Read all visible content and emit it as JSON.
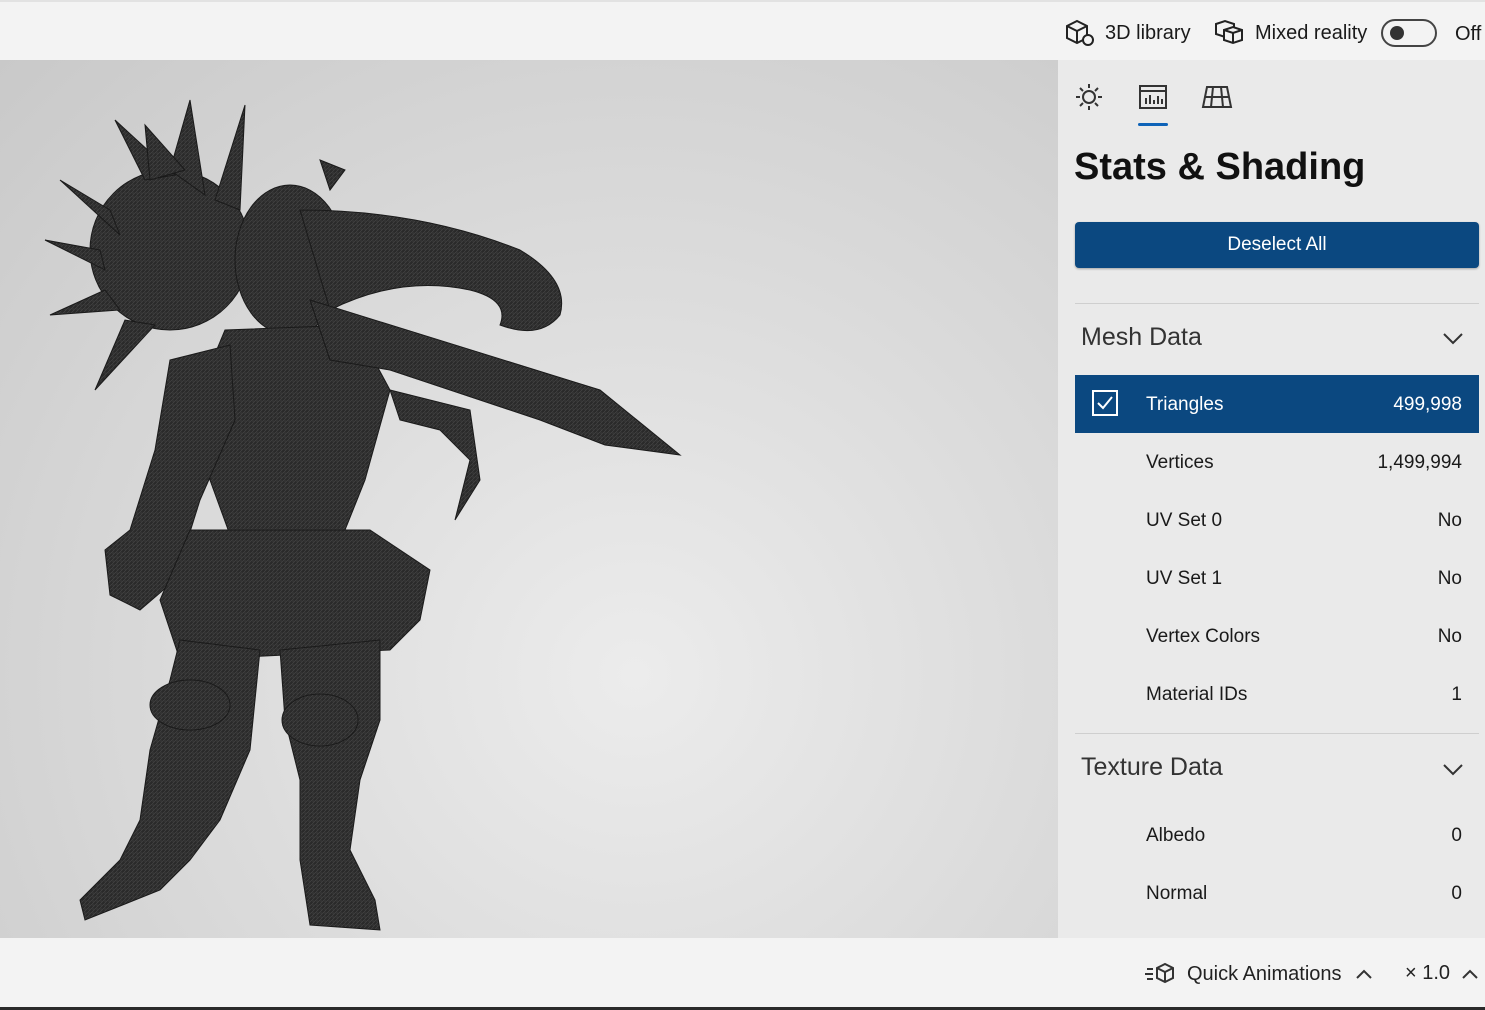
{
  "toolbar": {
    "library_label": "3D library",
    "mixed_reality_label": "Mixed reality",
    "toggle_state": "Off"
  },
  "panel": {
    "title": "Stats & Shading",
    "deselect_label": "Deselect All",
    "tabs": [
      "lighting-tab",
      "stats-tab",
      "grid-tab"
    ],
    "mesh": {
      "header": "Mesh Data",
      "rows": [
        {
          "label": "Triangles",
          "value": "499,998",
          "selected": true
        },
        {
          "label": "Vertices",
          "value": "1,499,994"
        },
        {
          "label": "UV Set 0",
          "value": "No"
        },
        {
          "label": "UV Set 1",
          "value": "No"
        },
        {
          "label": "Vertex Colors",
          "value": "No"
        },
        {
          "label": "Material IDs",
          "value": "1"
        }
      ]
    },
    "texture": {
      "header": "Texture Data",
      "rows": [
        {
          "label": "Albedo",
          "value": "0"
        },
        {
          "label": "Normal",
          "value": "0"
        }
      ]
    }
  },
  "bottombar": {
    "animations_label": "Quick Animations",
    "speed_label": "× 1.0"
  },
  "colors": {
    "accent": "#0b4880",
    "tab_indicator": "#0e63b8"
  }
}
